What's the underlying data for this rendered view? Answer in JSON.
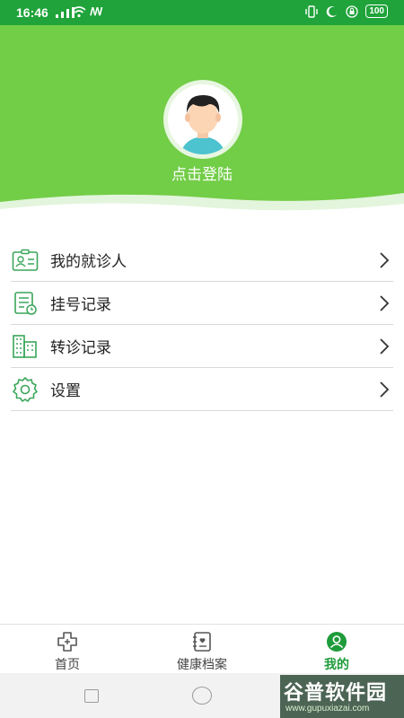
{
  "status_bar": {
    "time": "16:46",
    "nfc": "ꟿ",
    "battery": "100"
  },
  "header": {
    "login_text": "点击登陆"
  },
  "menu": {
    "items": [
      {
        "label": "我的就诊人",
        "icon": "patient-card-icon"
      },
      {
        "label": "挂号记录",
        "icon": "register-record-icon"
      },
      {
        "label": "转诊记录",
        "icon": "building-icon"
      },
      {
        "label": "设置",
        "icon": "gear-icon"
      }
    ]
  },
  "tabbar": {
    "tabs": [
      {
        "label": "首页",
        "icon": "home-cross-icon",
        "active": false
      },
      {
        "label": "健康档案",
        "icon": "health-record-icon",
        "active": false
      },
      {
        "label": "我的",
        "icon": "user-icon",
        "active": true
      }
    ]
  },
  "watermark": {
    "main": "谷普软件园",
    "url": "www.gupuxiazai.com"
  },
  "colors": {
    "status_bar": "#1fa33a",
    "header": "#72cd47",
    "accent": "#1e9b3a",
    "icon_green": "#3aa65a"
  }
}
